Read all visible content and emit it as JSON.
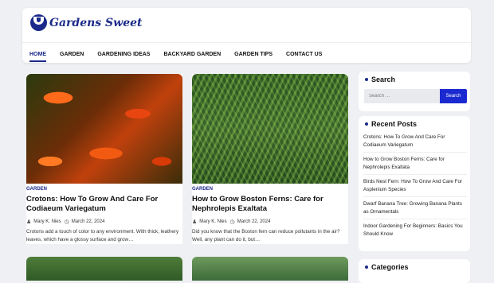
{
  "site": {
    "name": "Gardens Sweet"
  },
  "nav": [
    {
      "label": "HOME",
      "active": true
    },
    {
      "label": "GARDEN"
    },
    {
      "label": "GARDENING IDEAS"
    },
    {
      "label": "BACKYARD GARDEN"
    },
    {
      "label": "GARDEN TIPS"
    },
    {
      "label": "CONTACT US"
    }
  ],
  "posts": [
    {
      "category": "GARDEN",
      "title": "Crotons: How To Grow And Care For Codiaeum Variegatum",
      "author": "Mary K. Nies",
      "date": "March 22, 2024",
      "excerpt": "Crotons add a touch of color to any environment. With thick, leathery leaves, which have a glossy surface and grow…"
    },
    {
      "category": "GARDEN",
      "title": "How to Grow Boston Ferns: Care for Nephrolepis Exaltata",
      "author": "Mary K. Nies",
      "date": "March 22, 2024",
      "excerpt": "Did you know that the Boston fern can reduce pollutants in the air? Well, any plant can do it, but…"
    }
  ],
  "sidebar": {
    "search": {
      "title": "Search",
      "placeholder": "Search …",
      "button": "Search"
    },
    "recent": {
      "title": "Recent Posts",
      "items": [
        "Crotons: How To Grow And Care For Codiaeum Variegatum",
        "How to Grow Boston Ferns: Care for Nephrolepis Exaltata",
        "Birds Nest Fern: How To Grow And Care For Asplenium Species",
        "Dwarf Banana Tree: Growing Banana Plants as Ornamentals",
        "Indoor Gardening For Beginners: Basics You Should Know"
      ]
    },
    "categories": {
      "title": "Categories"
    }
  }
}
